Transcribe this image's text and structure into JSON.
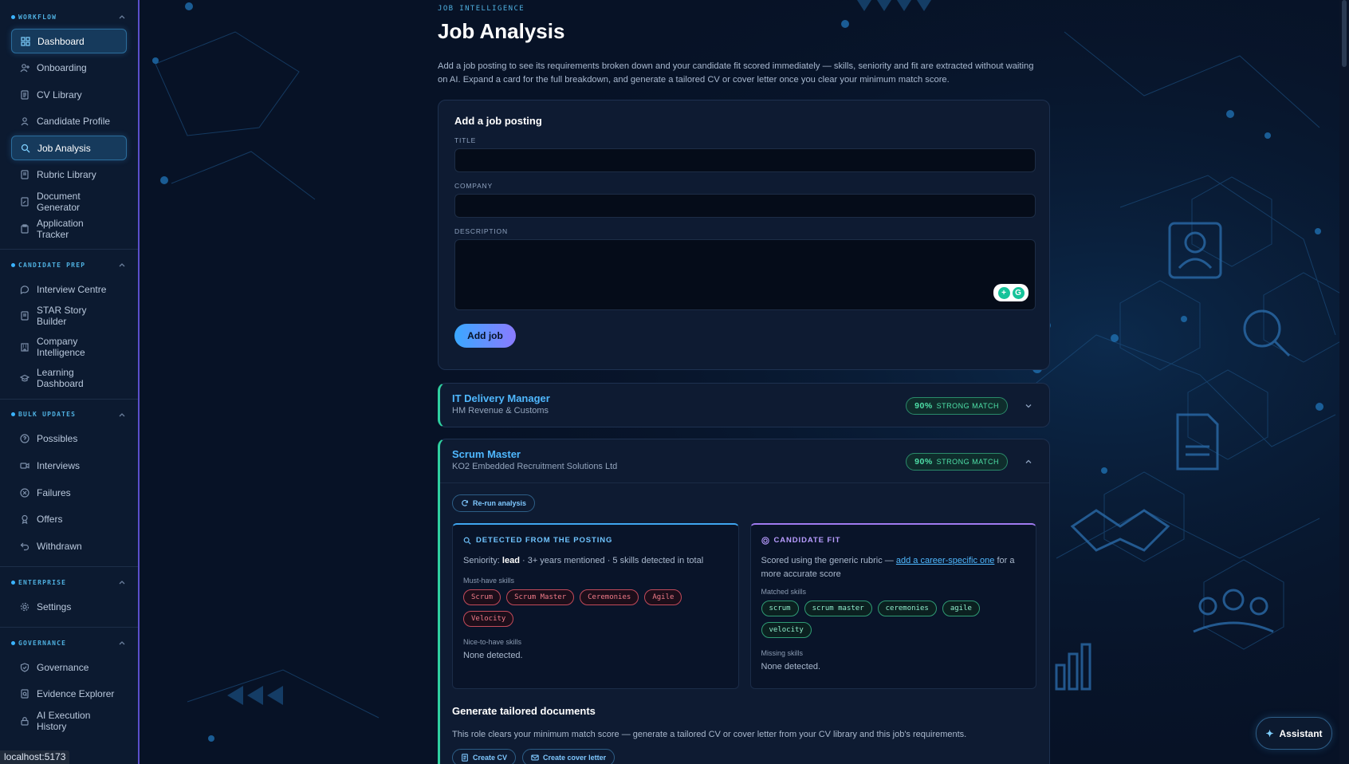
{
  "sidebar": {
    "sections": [
      {
        "title": "WORKFLOW",
        "items": [
          "Dashboard",
          "Onboarding",
          "CV Library",
          "Candidate Profile",
          "Job Analysis",
          "Rubric Library",
          "Document Generator",
          "Application Tracker"
        ]
      },
      {
        "title": "CANDIDATE PREP",
        "items": [
          "Interview Centre",
          "STAR Story Builder",
          "Company Intelligence",
          "Learning Dashboard"
        ]
      },
      {
        "title": "BULK UPDATES",
        "items": [
          "Possibles",
          "Interviews",
          "Failures",
          "Offers",
          "Withdrawn"
        ]
      },
      {
        "title": "ENTERPRISE",
        "items": [
          "Settings"
        ]
      },
      {
        "title": "GOVERNANCE",
        "items": [
          "Governance",
          "Evidence Explorer",
          "AI Execution History"
        ]
      }
    ]
  },
  "status_tip": "localhost:5173",
  "header": {
    "eyebrow": "JOB INTELLIGENCE",
    "title": "Job Analysis",
    "intro": "Add a job posting to see its requirements broken down and your candidate fit scored immediately — skills, seniority and fit are extracted without waiting on AI. Expand a card for the full breakdown, and generate a tailored CV or cover letter once you clear your minimum match score."
  },
  "add_form": {
    "heading": "Add a job posting",
    "title_label": "TITLE",
    "title_value": "",
    "company_label": "COMPANY",
    "company_value": "",
    "description_label": "DESCRIPTION",
    "description_value": "",
    "submit_label": "Add job"
  },
  "jobs": [
    {
      "title": "IT Delivery Manager",
      "company": "HM Revenue & Customs",
      "match_pct": "90%",
      "match_label": "STRONG MATCH",
      "expanded": false
    },
    {
      "title": "Scrum Master",
      "company": "KO2 Embedded Recruitment Solutions Ltd",
      "match_pct": "90%",
      "match_label": "STRONG MATCH",
      "expanded": true,
      "rerun_label": "Re-run analysis",
      "detected": {
        "title": "DETECTED FROM THE POSTING",
        "seniority_prefix": "Seniority: ",
        "seniority_value": "lead",
        "seniority_suffix": " · 3+ years mentioned · 5 skills detected in total",
        "must_have_label": "Must-have skills",
        "must_have": [
          "Scrum",
          "Scrum Master",
          "Ceremonies",
          "Agile",
          "Velocity"
        ],
        "nice_label": "Nice-to-have skills",
        "nice_value": "None detected."
      },
      "fit": {
        "title": "CANDIDATE FIT",
        "rubric_prefix": "Scored using the generic rubric — ",
        "rubric_link": "add a career-specific one",
        "rubric_suffix": " for a more accurate score",
        "matched_label": "Matched skills",
        "matched": [
          "scrum",
          "scrum master",
          "ceremonies",
          "agile",
          "velocity"
        ],
        "missing_label": "Missing skills",
        "missing_value": "None detected."
      },
      "generate": {
        "title": "Generate tailored documents",
        "text": "This role clears your minimum match score — generate a tailored CV or cover letter from your CV library and this job's requirements.",
        "create_cv": "Create CV",
        "create_cover": "Create cover letter"
      }
    }
  ],
  "assistant_label": "Assistant",
  "colors": {
    "background": "#071226",
    "accent": "#4fb8ff",
    "match_green": "#4ee0a8",
    "must_have_red": "#f07a88"
  }
}
